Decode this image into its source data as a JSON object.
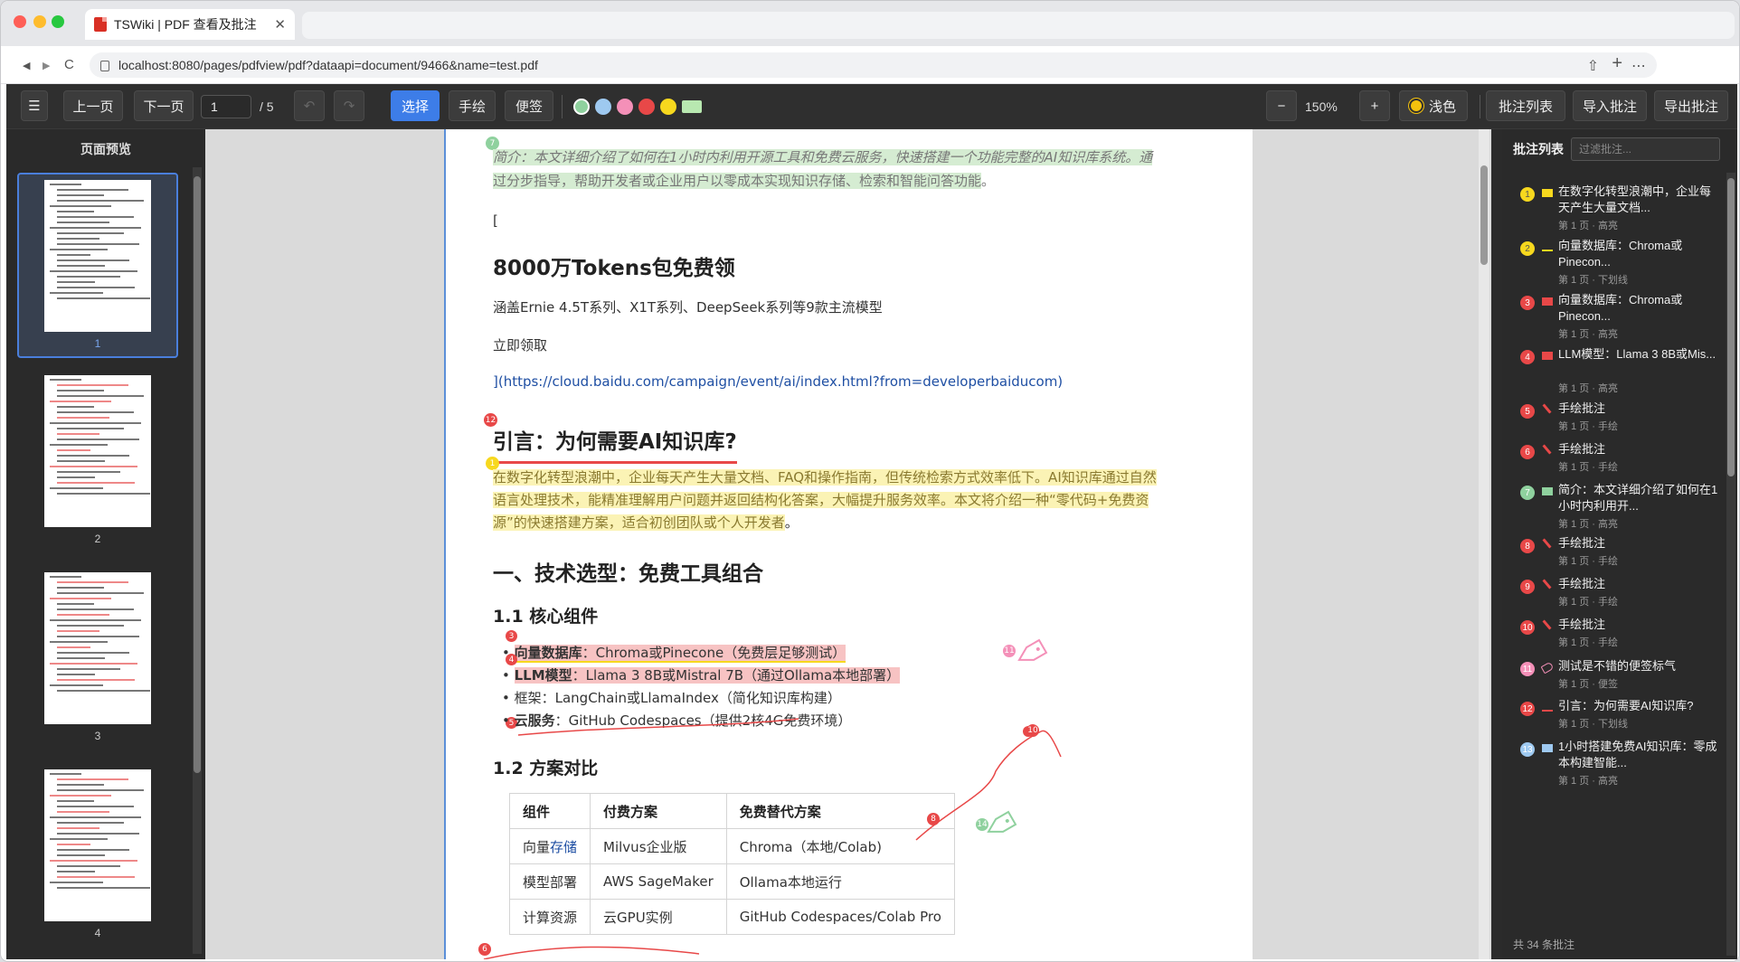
{
  "browser": {
    "tab_title": "TSWiki | PDF 查看及批注",
    "close": "✕",
    "url": "localhost:8080/pages/pdfview/pdf?dataapi=document/9466&name=test.pdf",
    "back": "◀",
    "forward": "▶",
    "reload": "C",
    "share": "⇧",
    "add": "+",
    "more": "⋯"
  },
  "toolbar": {
    "menu": "☰",
    "prev": "上一页",
    "next": "下一页",
    "page": "1",
    "total": "/ 5",
    "undo": "↶",
    "redo": "↷",
    "select": "选择",
    "draw": "手绘",
    "note": "便签",
    "zoom_out": "−",
    "zoom": "150%",
    "zoom_in": "+",
    "theme": "浅色",
    "list": "批注列表",
    "import": "导入批注",
    "export": "导出批注",
    "colors": [
      "#8fd19e",
      "#9ec9f0",
      "#f490b8",
      "#e84848",
      "#f7d81e",
      "#b8e8b0"
    ]
  },
  "left": {
    "title": "页面预览",
    "pages": [
      "1",
      "2",
      "3",
      "4"
    ]
  },
  "doc": {
    "intro": "简介：本文详细介绍了如何在1小时内利用开源工具和免费云服务，快速搭建一个功能完整的AI知识库系统。通",
    "intro2": "过分步指导，帮助开发者或企业用户以零成本实现知识存储、检索和智能问答功能",
    "intro_end": "。",
    "bracket": "[",
    "h_tokens": "8000万Tokens包免费领",
    "models": "涵盖Ernie 4.5T系列、X1T系列、DeepSeek系列等9款主流模型",
    "claim": "立即领取",
    "link": "](https://cloud.baidu.com/campaign/event/ai/index.html?from=developerbaiducom)",
    "h_why": "引言：为何需要AI知识库?",
    "p1": "在数字化转型浪潮中，企业每天产生大量文档、FAQ和操作指南，但传统检索方式效率低下。AI知识库通过自然",
    "p2": "语言处理技术，能精准理解用户问题并返回结构化答案，大幅提升服务效率。本文将介绍一种“零代码+免费资",
    "p3": "源”的快速搭建方案，适合初创团队或个人开发者",
    "p3_end": "。",
    "h_select": "一、技术选型：免费工具组合",
    "h_core": "1.1 核心组件",
    "b1k": "向量数据库",
    "b1v": "：Chroma或Pinecone（免费层足够测试）",
    "b2k": "LLM模型",
    "b2v": "：Llama 3 8B或Mistral 7B（通过Ollama本地部署）",
    "b3": "框架：LangChain或LlamaIndex（简化知识库构建）",
    "b4k": "云服务",
    "b4v": "：GitHub Codespaces（提供2核4G免费环境）",
    "h_cmp": "1.2 方案对比",
    "table": [
      [
        "组件",
        "付费方案",
        "免费替代方案"
      ],
      [
        "向量存储",
        "Milvus企业版",
        "Chroma（本地/Colab)"
      ],
      [
        "模型部署",
        "AWS SageMaker",
        "Ollama本地运行"
      ],
      [
        "计算资源",
        "云GPU实例",
        "GitHub Codespaces/Colab Pro"
      ]
    ],
    "markers": [
      "7",
      "12",
      "1",
      "3",
      "4",
      "5",
      "11",
      "10",
      "8",
      "14",
      "6"
    ]
  },
  "right": {
    "title": "批注列表",
    "filter_placeholder": "过滤批注...",
    "footer": "共 34 条批注",
    "items": [
      {
        "n": "1",
        "color": "#f7d81e",
        "icon": "highlight",
        "t": "在数字化转型浪潮中，企业每天产生大量文档...",
        "m": "第 1 页 · 高亮"
      },
      {
        "n": "2",
        "color": "#f7d81e",
        "icon": "underline",
        "t": "向量数据库：Chroma或Pinecon...",
        "m": "第 1 页 · 下划线"
      },
      {
        "n": "3",
        "color": "#e84848",
        "icon": "highlight",
        "t": "向量数据库：Chroma或Pinecon...",
        "m": "第 1 页 · 高亮"
      },
      {
        "n": "4",
        "color": "#e84848",
        "icon": "highlight",
        "t": "LLM模型：Llama 3 8B或Mis...",
        "m": "第 1 页 · 高亮"
      },
      {
        "n": "5",
        "color": "#e84848",
        "icon": "pen",
        "t": "手绘批注",
        "m": "第 1 页 · 手绘"
      },
      {
        "n": "6",
        "color": "#e84848",
        "icon": "pen",
        "t": "手绘批注",
        "m": "第 1 页 · 手绘"
      },
      {
        "n": "7",
        "color": "#8fd19e",
        "icon": "highlight",
        "t": "简介：本文详细介绍了如何在1小时内利用开...",
        "m": "第 1 页 · 高亮"
      },
      {
        "n": "8",
        "color": "#e84848",
        "icon": "pen",
        "t": "手绘批注",
        "m": "第 1 页 · 手绘"
      },
      {
        "n": "9",
        "color": "#e84848",
        "icon": "pen",
        "t": "手绘批注",
        "m": "第 1 页 · 手绘"
      },
      {
        "n": "10",
        "color": "#e84848",
        "icon": "pen",
        "t": "手绘批注",
        "m": "第 1 页 · 手绘"
      },
      {
        "n": "11",
        "color": "#f490b8",
        "icon": "tag",
        "t": "测试是不错的便签标气",
        "m": "第 1 页 · 便签"
      },
      {
        "n": "12",
        "color": "#e84848",
        "icon": "underline",
        "t": "引言：为何需要AI知识库?",
        "m": "第 1 页 · 下划线"
      },
      {
        "n": "13",
        "color": "#9ec9f0",
        "icon": "highlight",
        "t": "1小时搭建免费AI知识库：零成本构建智能...",
        "m": "第 1 页 · 高亮"
      }
    ]
  }
}
